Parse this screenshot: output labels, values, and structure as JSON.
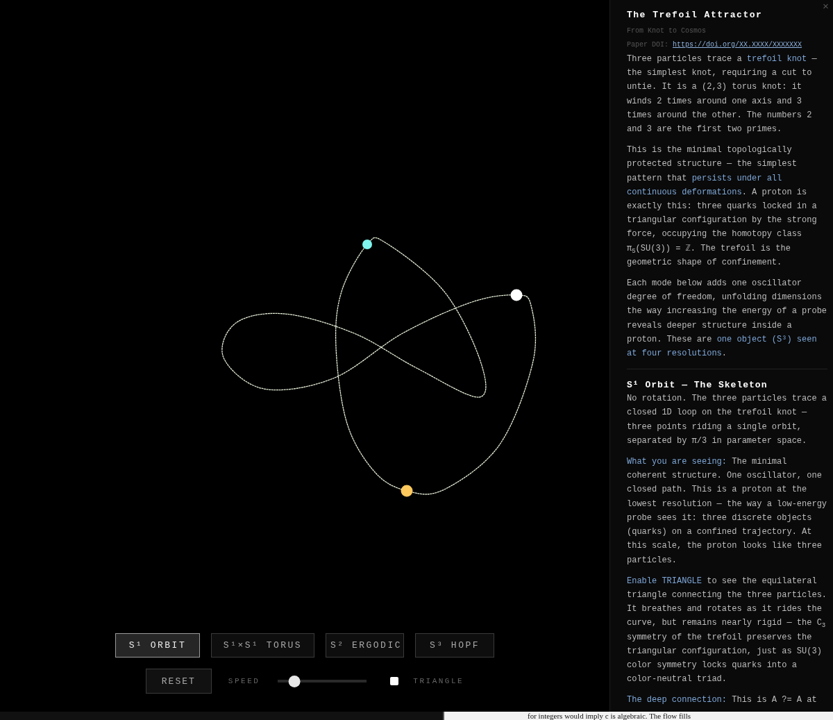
{
  "scene": {
    "particles": [
      {
        "color": "#7ff5ee"
      },
      {
        "color": "#ffffff"
      },
      {
        "color": "#ffc95e"
      }
    ]
  },
  "modes": [
    {
      "label": "S¹ ORBIT",
      "selected": true
    },
    {
      "label": "S¹×S¹ TORUS",
      "selected": false
    },
    {
      "label": "S² ERGODIC",
      "selected": false
    },
    {
      "label": "S³ HOPF",
      "selected": false
    }
  ],
  "controls": {
    "reset": "RESET",
    "speed": {
      "label": "SPEED",
      "level": 0.14
    },
    "triangle": {
      "label": "TRIANGLE",
      "checked": false
    }
  },
  "panel": {
    "close": "×",
    "title": "The Trefoil Attractor",
    "subtitle": "From Knot to Cosmos",
    "doi_label": "Paper DOI:",
    "doi_link": "https://doi.org/XX.XXXX/XXXXXXX",
    "intro": [
      [
        {
          "kind": "plain",
          "text": "Three particles trace a "
        },
        {
          "kind": "link",
          "text": "trefoil knot"
        },
        {
          "kind": "plain",
          "text": " — the simplest knot, requiring a cut to untie. It is a (2,3) torus knot: it winds 2 times around one axis and 3 times around the other. The numbers 2 and 3 are the first two primes."
        }
      ],
      [
        {
          "kind": "plain",
          "text": "This is the minimal topologically protected structure — the simplest pattern that "
        },
        {
          "kind": "link",
          "text": "persists under all continuous deformations"
        },
        {
          "kind": "plain",
          "text": ". A proton is exactly this: three quarks locked in a triangular configuration by the strong force, occupying the homotopy class π$_{5}$(SU(3)) = ℤ. The trefoil is the geometric shape of confinement."
        }
      ],
      [
        {
          "kind": "plain",
          "text": "Each mode below adds one oscillator degree of freedom, unfolding dimensions the way increasing the energy of a probe reveals deeper structure inside a proton. These are "
        },
        {
          "kind": "link",
          "text": "one object (S³) seen at four resolutions"
        },
        {
          "kind": "plain",
          "text": "."
        }
      ]
    ],
    "section_title": "S¹ Orbit — The Skeleton",
    "section": [
      [
        {
          "kind": "plain",
          "text": "No rotation. The three particles trace a closed 1D loop on the trefoil knot — three points riding a single orbit, separated by π/3 in parameter space."
        }
      ],
      [
        {
          "kind": "link",
          "text": "What you are seeing:"
        },
        {
          "kind": "plain",
          "text": " The minimal coherent structure. One oscillator, one closed path. This is a proton at the lowest resolution — the way a low-energy probe sees it: three discrete objects (quarks) on a confined trajectory. At this scale, the proton looks like three particles."
        }
      ],
      [
        {
          "kind": "link",
          "text": "Enable TRIANGLE"
        },
        {
          "kind": "plain",
          "text": " to see the equilateral triangle connecting the three particles. It breathes and rotates as it rides the curve, but remains nearly rigid — the C$_{3}$ symmetry of the trefoil preserves the triangular configuration, just as SU(3) color symmetry locks quarks into a color-neutral triad."
        }
      ],
      [
        {
          "kind": "link",
          "text": "The deep connection:"
        },
        {
          "kind": "plain",
          "text": " This is A ?= A at"
        }
      ]
    ]
  },
  "underlay": {
    "text": "for integers would imply c is algebraic. The flow fills"
  }
}
